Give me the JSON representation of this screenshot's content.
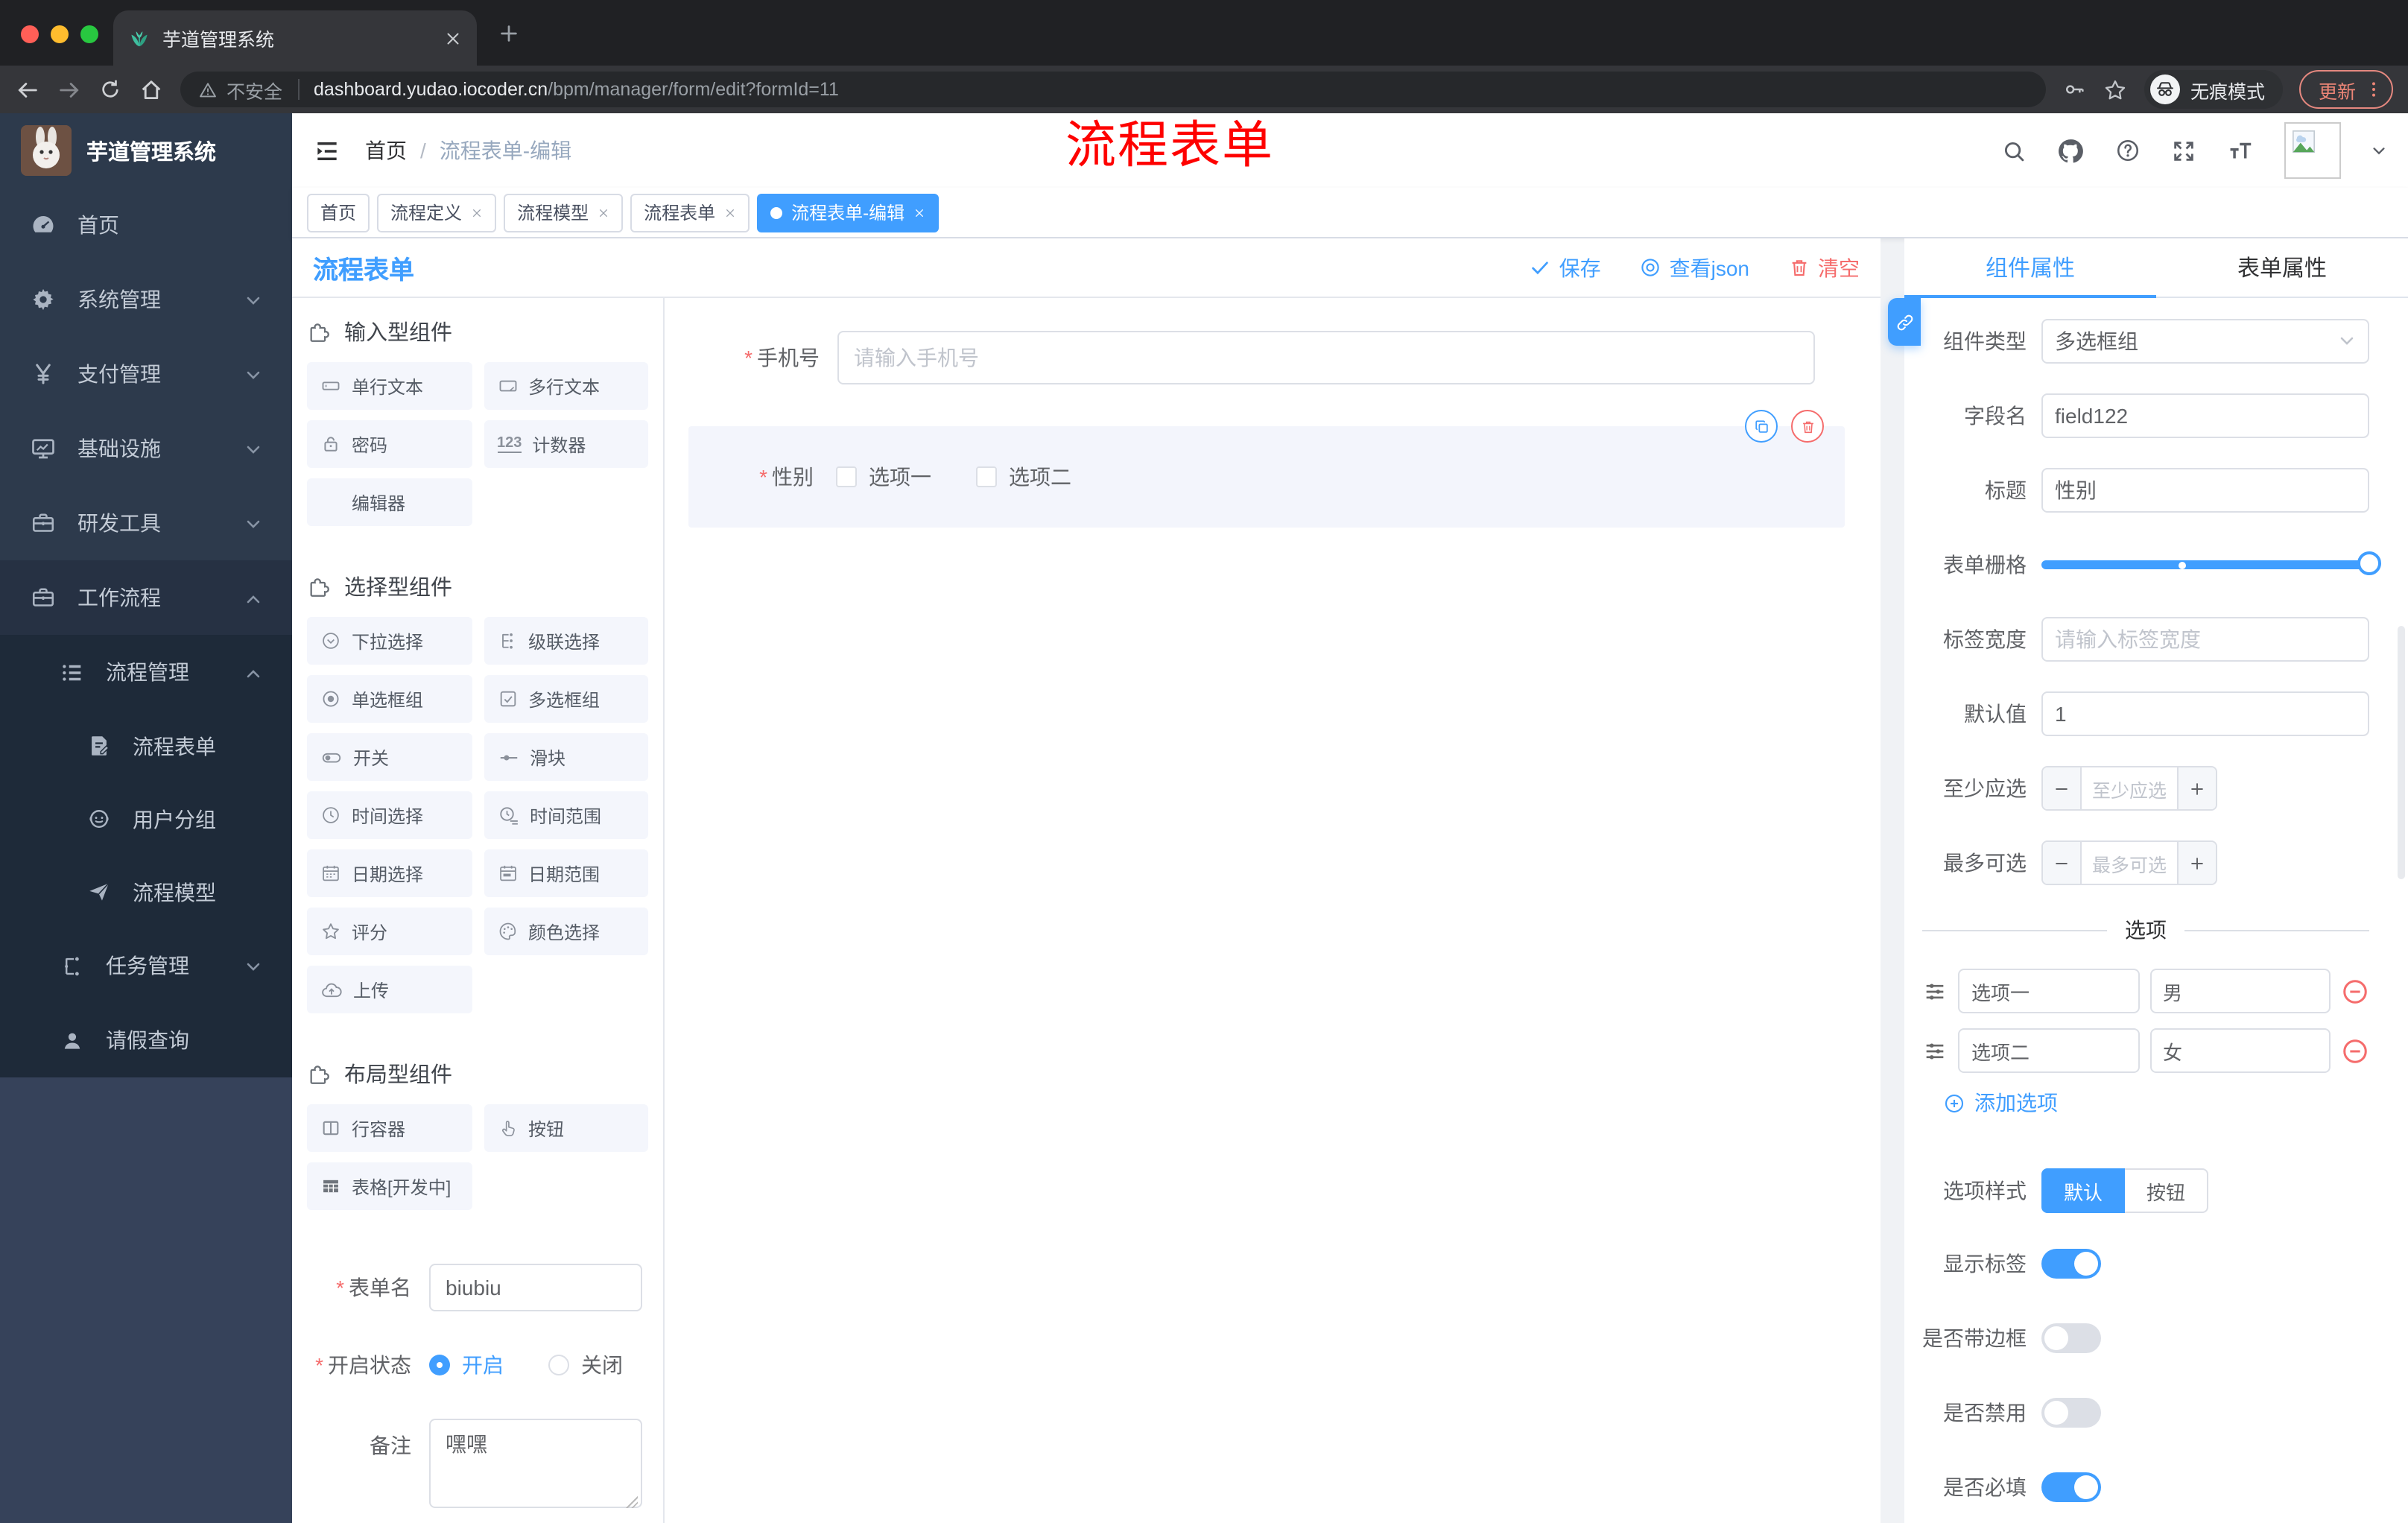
{
  "colors": {
    "accent": "#409eff",
    "danger": "#f56c6c",
    "overlay_red": "#fe0100",
    "sidebar_bg": "#2d3a4c",
    "submenu_bg": "#1e2a39"
  },
  "misc": {
    "required_mark": "*",
    "breadcrumb_sep": "/"
  },
  "browser": {
    "tab_title": "芋道管理系统",
    "security_label": "不安全",
    "url_host": "dashboard.yudao.iocoder.cn",
    "url_path": "/bpm/manager/form/edit?formId=11",
    "incognito_label": "无痕模式",
    "update_label": "更新"
  },
  "sidebar": {
    "logo_title": "芋道管理系统",
    "items": [
      {
        "label": "首页"
      },
      {
        "label": "系统管理"
      },
      {
        "label": "支付管理"
      },
      {
        "label": "基础设施"
      },
      {
        "label": "研发工具"
      },
      {
        "label": "工作流程"
      }
    ],
    "workflow_children": [
      {
        "label": "流程管理"
      },
      {
        "label": "流程表单"
      },
      {
        "label": "用户分组"
      },
      {
        "label": "流程模型"
      },
      {
        "label": "任务管理"
      },
      {
        "label": "请假查询"
      }
    ]
  },
  "header": {
    "breadcrumb": [
      "首页",
      "流程表单-编辑"
    ],
    "overlay_text": "流程表单",
    "tabs": [
      {
        "label": "首页"
      },
      {
        "label": "流程定义"
      },
      {
        "label": "流程模型"
      },
      {
        "label": "流程表单"
      },
      {
        "label": "流程表单-编辑"
      }
    ]
  },
  "designer": {
    "title": "流程表单",
    "save_label": "保存",
    "view_json_label": "查看json",
    "clear_label": "清空"
  },
  "components_panel": {
    "sections": [
      {
        "title": "输入型组件",
        "items": [
          {
            "label": "单行文本"
          },
          {
            "label": "多行文本"
          },
          {
            "label": "密码"
          },
          {
            "label": "计数器",
            "icon_text": "123"
          },
          {
            "label": "编辑器"
          }
        ]
      },
      {
        "title": "选择型组件",
        "items": [
          {
            "label": "下拉选择"
          },
          {
            "label": "级联选择"
          },
          {
            "label": "单选框组"
          },
          {
            "label": "多选框组"
          },
          {
            "label": "开关"
          },
          {
            "label": "滑块"
          },
          {
            "label": "时间选择"
          },
          {
            "label": "时间范围"
          },
          {
            "label": "日期选择"
          },
          {
            "label": "日期范围"
          },
          {
            "label": "评分"
          },
          {
            "label": "颜色选择"
          },
          {
            "label": "上传"
          }
        ]
      },
      {
        "title": "布局型组件",
        "items": [
          {
            "label": "行容器"
          },
          {
            "label": "按钮"
          },
          {
            "label": "表格[开发中]"
          }
        ]
      }
    ],
    "form": {
      "name_label": "表单名",
      "name_value": "biubiu",
      "status_label": "开启状态",
      "status_on": "开启",
      "status_off": "关闭",
      "status_selected": "开启",
      "remark_label": "备注",
      "remark_value": "嘿嘿"
    }
  },
  "canvas": {
    "phone_label": "手机号",
    "phone_placeholder": "请输入手机号",
    "gender_label": "性别",
    "gender_options": [
      "选项一",
      "选项二"
    ]
  },
  "props": {
    "tab_component": "组件属性",
    "tab_form": "表单属性",
    "active_tab": "组件属性",
    "rows": {
      "type_label": "组件类型",
      "type_value": "多选框组",
      "field_label": "字段名",
      "field_value": "field122",
      "title_label": "标题",
      "title_value": "性别",
      "grid_label": "表单栅格",
      "width_label": "标签宽度",
      "width_placeholder": "请输入标签宽度",
      "default_label": "默认值",
      "default_value": "1",
      "min_label": "至少应选",
      "min_placeholder": "至少应选",
      "max_label": "最多可选",
      "max_placeholder": "最多可选"
    },
    "options": {
      "divider": "选项",
      "rows": [
        {
          "name": "选项一",
          "value": "男"
        },
        {
          "name": "选项二",
          "value": "女"
        }
      ],
      "add_label": "添加选项"
    },
    "style": {
      "label": "选项样式",
      "seg_default": "默认",
      "seg_button": "按钮",
      "seg_active": "默认",
      "toggles": [
        {
          "label": "显示标签",
          "on": true
        },
        {
          "label": "是否带边框",
          "on": false
        },
        {
          "label": "是否禁用",
          "on": false
        },
        {
          "label": "是否必填",
          "on": true
        }
      ]
    }
  }
}
